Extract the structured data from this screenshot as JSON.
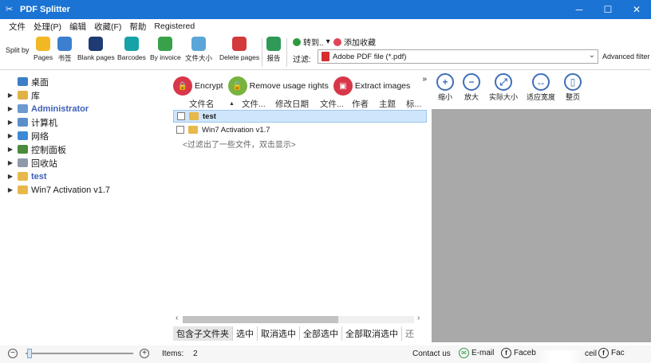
{
  "window": {
    "title": "PDF Splitter",
    "controls": [
      "─",
      "☐",
      "✕"
    ]
  },
  "menu": [
    "文件",
    "处理(P)",
    "编辑",
    "收藏(F)",
    "帮助",
    "Registered"
  ],
  "ribbon": {
    "split_by_label": "Split by",
    "buttons": [
      {
        "label": "Pages",
        "color": "#f2b824"
      },
      {
        "label": "书签",
        "color": "#3c7fd1"
      },
      {
        "label": "Blank pages",
        "color": "#1f3b73"
      },
      {
        "label": "Barcodes",
        "color": "#16a3a8"
      },
      {
        "label": "By invoice",
        "color": "#38a24a"
      },
      {
        "label": "文件大小",
        "color": "#5aa6d8"
      },
      {
        "label": "Delete pages",
        "color": "#d33a3a"
      },
      {
        "label": "报告",
        "color": "#2f9a57"
      }
    ],
    "goto_label": "转到..",
    "favorite_label": "添加收藏",
    "filter_label": "过滤:",
    "filter_value": "Adobe PDF file (*.pdf)",
    "advanced_filter_label": "Advanced filter"
  },
  "tree": {
    "items": [
      {
        "label": "桌面",
        "bold": false,
        "icon_color": "#3d7fc7",
        "arrow": ""
      },
      {
        "label": "库",
        "bold": false,
        "icon_color": "#e0b347",
        "arrow": "▶"
      },
      {
        "label": "Administrator",
        "bold": true,
        "icon_color": "#6a9ad0",
        "arrow": "▶"
      },
      {
        "label": "计算机",
        "bold": false,
        "icon_color": "#5b8fc9",
        "arrow": "▶"
      },
      {
        "label": "网络",
        "bold": false,
        "icon_color": "#3c8ad6",
        "arrow": "▶"
      },
      {
        "label": "控制面板",
        "bold": false,
        "icon_color": "#4a8b3c",
        "arrow": "▶"
      },
      {
        "label": "回收站",
        "bold": false,
        "icon_color": "#8f9aa8",
        "arrow": "▶"
      },
      {
        "label": "test",
        "bold": true,
        "icon_color": "#e8b84a",
        "arrow": "▶"
      },
      {
        "label": "Win7 Activation v1.7",
        "bold": false,
        "icon_color": "#e8b84a",
        "arrow": "▶"
      }
    ]
  },
  "file_panel": {
    "actions": [
      {
        "label": "Encrypt",
        "color": "#d8374a"
      },
      {
        "label": "Remove usage rights",
        "color": "#77b33d"
      },
      {
        "label": "Extract images",
        "color": "#d8374a"
      }
    ],
    "more_chevron": "»",
    "columns": [
      "文件名",
      "文件...",
      "修改日期",
      "文件...",
      "作者",
      "主题",
      "标..."
    ],
    "sort_indicator": "▲",
    "rows": [
      {
        "name": "test",
        "selected": true
      },
      {
        "name": "Win7 Activation v1.7",
        "selected": false
      }
    ],
    "hint": "<过滤出了一些文件，双击显示>",
    "bottom_tabs": [
      "包含子文件夹",
      "选中",
      "取消选中",
      "全部选中",
      "全部取消选中",
      "还"
    ]
  },
  "preview": {
    "tools": [
      {
        "label": "缩小",
        "symbol": "+"
      },
      {
        "label": "放大",
        "symbol": "−"
      },
      {
        "label": "实际大小",
        "symbol": "⤢"
      },
      {
        "label": "适应宽度",
        "symbol": "↔"
      },
      {
        "label": "整页",
        "symbol": "▯"
      }
    ]
  },
  "status": {
    "items_label": "Items:",
    "items_count": "2",
    "contact_label": "Contact us",
    "email_label": "E-mail",
    "facebook_label": "Faceb",
    "cell_label": "ceil",
    "facebook2_label": "Fac"
  }
}
